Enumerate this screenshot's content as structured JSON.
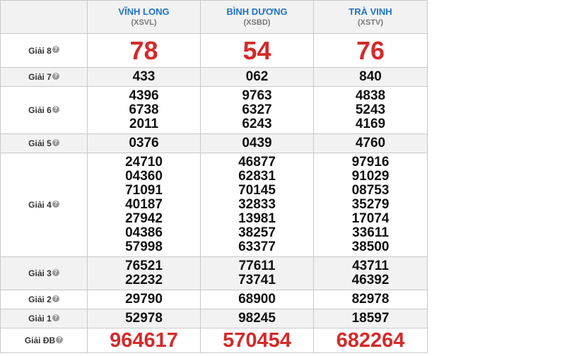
{
  "provinces": [
    {
      "name": "VĨNH LONG",
      "code": "(XSVL)"
    },
    {
      "name": "BÌNH DƯƠNG",
      "code": "(XSBD)"
    },
    {
      "name": "TRÀ VINH",
      "code": "(XSTV)"
    }
  ],
  "help_icon_glyph": "?",
  "prizes": [
    {
      "label": "Giải 8",
      "style": "big-red",
      "row": "r-g8",
      "stripe": false,
      "values": [
        [
          "78"
        ],
        [
          "54"
        ],
        [
          "76"
        ]
      ]
    },
    {
      "label": "Giải 7",
      "style": "normal",
      "row": "r-g7",
      "stripe": true,
      "values": [
        [
          "433"
        ],
        [
          "062"
        ],
        [
          "840"
        ]
      ]
    },
    {
      "label": "Giải 6",
      "style": "normal",
      "row": "r-g6",
      "stripe": false,
      "values": [
        [
          "4396",
          "6738",
          "2011"
        ],
        [
          "9763",
          "6327",
          "6243"
        ],
        [
          "4838",
          "5243",
          "4169"
        ]
      ]
    },
    {
      "label": "Giải 5",
      "style": "normal",
      "row": "r-g5",
      "stripe": true,
      "values": [
        [
          "0376"
        ],
        [
          "0439"
        ],
        [
          "4760"
        ]
      ]
    },
    {
      "label": "Giải 4",
      "style": "normal",
      "row": "r-g4",
      "stripe": false,
      "values": [
        [
          "24710",
          "04360",
          "71091",
          "40187",
          "27942",
          "04386",
          "57998"
        ],
        [
          "46877",
          "62831",
          "70145",
          "32833",
          "13981",
          "38257",
          "63377"
        ],
        [
          "97916",
          "91029",
          "08753",
          "35279",
          "17074",
          "33611",
          "38500"
        ]
      ]
    },
    {
      "label": "Giải 3",
      "style": "normal",
      "row": "r-g3",
      "stripe": true,
      "values": [
        [
          "76521",
          "22232"
        ],
        [
          "77611",
          "73741"
        ],
        [
          "43711",
          "46392"
        ]
      ]
    },
    {
      "label": "Giải 2",
      "style": "normal",
      "row": "r-g2",
      "stripe": false,
      "values": [
        [
          "29790"
        ],
        [
          "68900"
        ],
        [
          "82978"
        ]
      ]
    },
    {
      "label": "Giải 1",
      "style": "normal",
      "row": "r-g1",
      "stripe": true,
      "values": [
        [
          "52978"
        ],
        [
          "98245"
        ],
        [
          "18597"
        ]
      ]
    },
    {
      "label": "Giải ĐB",
      "style": "jackpot",
      "row": "r-db",
      "stripe": false,
      "values": [
        [
          "964617"
        ],
        [
          "570454"
        ],
        [
          "682264"
        ]
      ]
    }
  ]
}
